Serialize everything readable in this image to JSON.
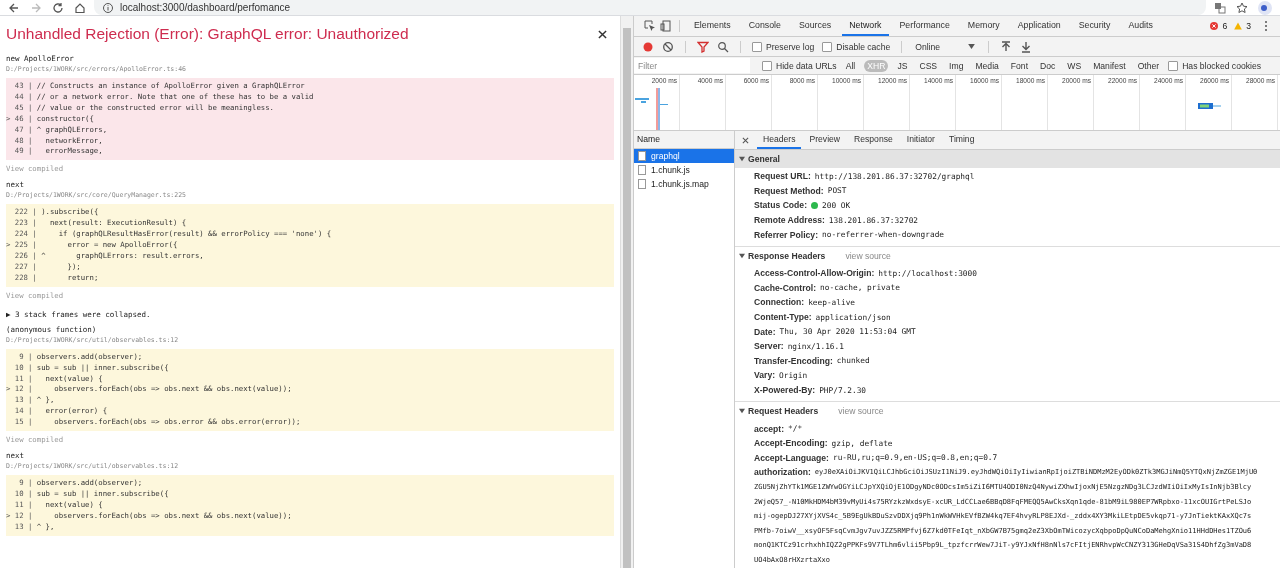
{
  "browser": {
    "url": "localhost:3000/dashboard/perfomance"
  },
  "error_overlay": {
    "title": "Unhandled Rejection (Error): GraphQL error: Unauthorized",
    "frames": [
      {
        "kind": "frame",
        "function": "new ApolloError",
        "location": "D:/Projects/1WORK/src/errors/ApolloError.ts:46",
        "is_error": true,
        "view_compiled": "View compiled",
        "lines": [
          {
            "gutter": "  43 |",
            "code": " // Constructs an instance of ApolloError given a GraphQLError"
          },
          {
            "gutter": "  44 |",
            "code": " // or a network error. Note that one of these has to be a valid"
          },
          {
            "gutter": "  45 |",
            "code": " // value or the constructed error will be meaningless."
          },
          {
            "gutter": "> 46 |",
            "code": " constructor({"
          },
          {
            "gutter": "  47 |",
            "code": " ^ graphQLErrors,"
          },
          {
            "gutter": "  48 |",
            "code": "   networkError,"
          },
          {
            "gutter": "  49 |",
            "code": "   errorMessage,"
          }
        ]
      },
      {
        "kind": "frame",
        "function": "next",
        "location": "D:/Projects/1WORK/src/core/QueryManager.ts:225",
        "is_error": false,
        "view_compiled": "View compiled",
        "lines": [
          {
            "gutter": "  222 |",
            "code": " ).subscribe({"
          },
          {
            "gutter": "  223 |",
            "code": "   next(result: ExecutionResult) {"
          },
          {
            "gutter": "  224 |",
            "code": "     if (graphQLResultHasError(result) && errorPolicy === 'none') {"
          },
          {
            "gutter": "> 225 |",
            "code": "       error = new ApolloError({"
          },
          {
            "gutter": "  226 |",
            "code": " ^       graphQLErrors: result.errors,"
          },
          {
            "gutter": "  227 |",
            "code": "       });"
          },
          {
            "gutter": "  228 |",
            "code": "       return;"
          }
        ]
      },
      {
        "kind": "collapsed",
        "text": "▶ 3 stack frames were collapsed."
      },
      {
        "kind": "frame",
        "function": "(anonymous function)",
        "location": "D:/Projects/1WORK/src/util/observables.ts:12",
        "is_error": false,
        "view_compiled": "View compiled",
        "lines": [
          {
            "gutter": "   9 |",
            "code": " observers.add(observer);"
          },
          {
            "gutter": "  10 |",
            "code": " sub = sub || inner.subscribe({"
          },
          {
            "gutter": "  11 |",
            "code": "   next(value) {"
          },
          {
            "gutter": "> 12 |",
            "code": "     observers.forEach(obs => obs.next && obs.next(value));"
          },
          {
            "gutter": "  13 |",
            "code": " ^ },"
          },
          {
            "gutter": "  14 |",
            "code": "   error(error) {"
          },
          {
            "gutter": "  15 |",
            "code": "     observers.forEach(obs => obs.error && obs.error(error));"
          }
        ]
      },
      {
        "kind": "frame",
        "function": "next",
        "location": "D:/Projects/1WORK/src/util/observables.ts:12",
        "is_error": false,
        "lines": [
          {
            "gutter": "   9 |",
            "code": " observers.add(observer);"
          },
          {
            "gutter": "  10 |",
            "code": " sub = sub || inner.subscribe({"
          },
          {
            "gutter": "  11 |",
            "code": "   next(value) {"
          },
          {
            "gutter": "> 12 |",
            "code": "     observers.forEach(obs => obs.next && obs.next(value));"
          },
          {
            "gutter": "  13 |",
            "code": " ^ },"
          }
        ]
      }
    ]
  },
  "devtools": {
    "tabs": [
      {
        "label": "Elements",
        "selected": false
      },
      {
        "label": "Console",
        "selected": false
      },
      {
        "label": "Sources",
        "selected": false
      },
      {
        "label": "Network",
        "selected": true
      },
      {
        "label": "Performance",
        "selected": false
      },
      {
        "label": "Memory",
        "selected": false
      },
      {
        "label": "Application",
        "selected": false
      },
      {
        "label": "Security",
        "selected": false
      },
      {
        "label": "Audits",
        "selected": false
      }
    ],
    "error_count": "6",
    "warning_count": "3",
    "recording": true,
    "filter_active": true,
    "toolbar_checkboxes": [
      {
        "label": "Preserve log",
        "checked": false
      },
      {
        "label": "Disable cache",
        "checked": false
      }
    ],
    "throttling": "Online",
    "filter": {
      "placeholder": "Filter"
    },
    "hide_data_urls": {
      "label": "Hide data URLs",
      "checked": false
    },
    "type_filters": [
      {
        "label": "All",
        "selected": false
      },
      {
        "label": "XHR",
        "selected": true
      },
      {
        "label": "JS",
        "selected": false
      },
      {
        "label": "CSS",
        "selected": false
      },
      {
        "label": "Img",
        "selected": false
      },
      {
        "label": "Media",
        "selected": false
      },
      {
        "label": "Font",
        "selected": false
      },
      {
        "label": "Doc",
        "selected": false
      },
      {
        "label": "WS",
        "selected": false
      },
      {
        "label": "Manifest",
        "selected": false
      },
      {
        "label": "Other",
        "selected": false
      }
    ],
    "blocked_cookies": {
      "label": "Has blocked cookies",
      "checked": false
    },
    "timeline_ticks": [
      "2000 ms",
      "4000 ms",
      "6000 ms",
      "8000 ms",
      "10000 ms",
      "12000 ms",
      "14000 ms",
      "16000 ms",
      "18000 ms",
      "20000 ms",
      "22000 ms",
      "24000 ms",
      "26000 ms",
      "28000 ms"
    ],
    "name_column": "Name",
    "requests": [
      {
        "name": "graphql",
        "selected": true
      },
      {
        "name": "1.chunk.js",
        "selected": false
      },
      {
        "name": "1.chunk.js.map",
        "selected": false
      }
    ],
    "detail_tabs": [
      {
        "label": "Headers",
        "selected": true
      },
      {
        "label": "Preview",
        "selected": false
      },
      {
        "label": "Response",
        "selected": false
      },
      {
        "label": "Initiator",
        "selected": false
      },
      {
        "label": "Timing",
        "selected": false
      }
    ],
    "sections": [
      {
        "title": "General",
        "expanded": true,
        "rows": [
          {
            "key": "Request URL:",
            "value": "http://138.201.86.37:32702/graphql"
          },
          {
            "key": "Request Method:",
            "value": "POST"
          },
          {
            "key": "Status Code:",
            "value": "200 OK",
            "status_dot": true
          },
          {
            "key": "Remote Address:",
            "value": "138.201.86.37:32702"
          },
          {
            "key": "Referrer Policy:",
            "value": "no-referrer-when-downgrade"
          }
        ]
      },
      {
        "title": "Response Headers",
        "expanded": true,
        "link": "view source",
        "rows": [
          {
            "key": "Access-Control-Allow-Origin:",
            "value": "http://localhost:3000"
          },
          {
            "key": "Cache-Control:",
            "value": "no-cache, private"
          },
          {
            "key": "Connection:",
            "value": "keep-alive"
          },
          {
            "key": "Content-Type:",
            "value": "application/json"
          },
          {
            "key": "Date:",
            "value": "Thu, 30 Apr 2020 11:53:04 GMT"
          },
          {
            "key": "Server:",
            "value": "nginx/1.16.1"
          },
          {
            "key": "Transfer-Encoding:",
            "value": "chunked"
          },
          {
            "key": "Vary:",
            "value": "Origin"
          },
          {
            "key": "X-Powered-By:",
            "value": "PHP/7.2.30"
          }
        ]
      },
      {
        "title": "Request Headers",
        "expanded": true,
        "link": "view source",
        "rows": [
          {
            "key": "accept:",
            "value": "*/*"
          },
          {
            "key": "Accept-Encoding:",
            "value": "gzip, deflate"
          },
          {
            "key": "Accept-Language:",
            "value": "ru-RU,ru;q=0.9,en-US;q=0.8,en;q=0.7"
          },
          {
            "key": "authorization:",
            "value": "eyJ0eXAiOiJKV1QiLCJhbGciOiJSUzI1NiJ9.eyJhdWQiOiIyIiwianRpIjoiZTBiNDMzM2EyODk0ZTk3MGJiNmQ5YTQxNjZmZGE1MjU0",
            "more": [
              "ZGU5NjZhYTk1MGE1ZWYwOGYiLCJpYXQiOjE1ODgyNDc0ODcsIm5iZiI6MTU4ODI0NzQ4NywiZXhwIjoxNjE5NzgzNDg3LCJzdWIiOiIxMyIsInNjb3Blcy",
              "2WjeQ57_-N10MkHDM4bM39vMyUi4s75RYzkzWxdsyE-xcUR_LdCCLae6BBqD8FqFMEQQ5AwCksXqn1qde-81bM9iL980EP7WRpbxo-11xcOUIGrtPeLSJo",
              "mij-ogepDJ27XYjXVS4c_5B9EgUkBDuSzvDDXjq9Ph1nWkWVHkEVfBZW4kq7EF4hvyRLP8EJXd-_zddx4XY3MkiLEtpDE5vkqp71-y7JnTiektKAxXQc7s",
              "PMfb-7oiwV__xsyOF5FsqCvmJgv7uvJZZ5RMPfvj6Z7kd0TFeIqt_nXbGW7B75gmq2eZ3XbOmTWicozycXqbpoDpQuNCoDaMehgXnio11HHdDHes1TZOu6",
              "monQ1KTCz91crhxhhIQZ2gPPKFs9V7TLhm6vlii5Pbp9L_tpzfcrrWew7JiT-y9YJxNfH8nNls7cFItjENRhvpWcCNZY313GHeDqVSa31S4DhfZg3mVaD8",
              "UO4bAxO8rHXzrtaXxo"
            ]
          }
        ]
      }
    ]
  }
}
